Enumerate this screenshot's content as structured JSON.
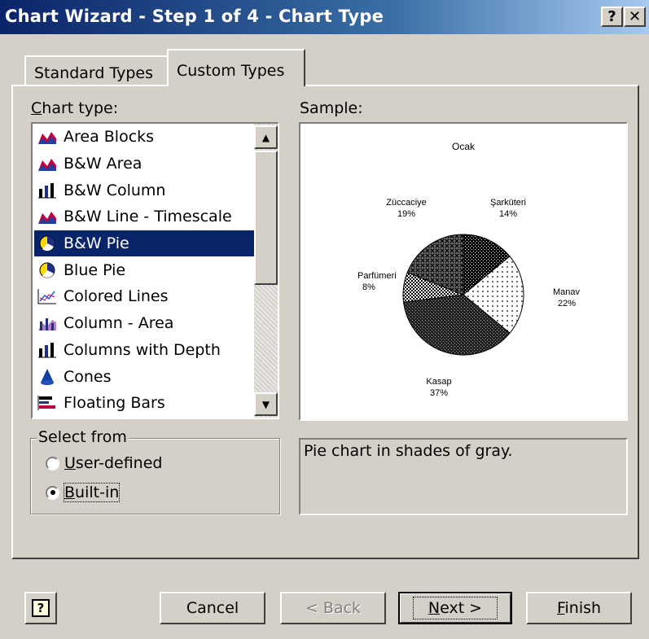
{
  "window": {
    "title": "Chart Wizard - Step 1 of 4 - Chart Type",
    "help_button": "?",
    "close_button": "✕"
  },
  "tabs": [
    {
      "label": "Standard Types",
      "active": false
    },
    {
      "label": "Custom Types",
      "active": true
    }
  ],
  "chart_type": {
    "label_accel": "C",
    "label_rest": "hart type:",
    "items": [
      {
        "label": "Area Blocks",
        "icon": "area-chart-icon"
      },
      {
        "label": "B&W Area",
        "icon": "area-chart-icon"
      },
      {
        "label": "B&W Column",
        "icon": "column-chart-icon"
      },
      {
        "label": "B&W Line - Timescale",
        "icon": "area-chart-icon"
      },
      {
        "label": "B&W Pie",
        "icon": "pie-chart-icon",
        "selected": true
      },
      {
        "label": "Blue Pie",
        "icon": "pie-chart-icon"
      },
      {
        "label": "Colored Lines",
        "icon": "line-chart-icon"
      },
      {
        "label": "Column - Area",
        "icon": "column-area-chart-icon"
      },
      {
        "label": "Columns with Depth",
        "icon": "column-chart-icon"
      },
      {
        "label": "Cones",
        "icon": "cone-chart-icon"
      },
      {
        "label": "Floating Bars",
        "icon": "bar-chart-icon"
      }
    ]
  },
  "sample": {
    "label": "Sample:",
    "chart_data": {
      "type": "pie",
      "title": "Ocak",
      "slices": [
        {
          "label": "Şarküteri",
          "value": 14,
          "display": "14%"
        },
        {
          "label": "Manav",
          "value": 22,
          "display": "22%"
        },
        {
          "label": "Kasap",
          "value": 37,
          "display": "37%"
        },
        {
          "label": "Parfümeri",
          "value": 8,
          "display": "8%"
        },
        {
          "label": "Züccaciye",
          "value": 19,
          "display": "19%"
        }
      ],
      "colors": "shades of gray patterns"
    }
  },
  "select_from": {
    "legend": "Select from",
    "options": [
      {
        "accel": "U",
        "rest": "ser-defined",
        "checked": false
      },
      {
        "accel": "B",
        "rest": "uilt-in",
        "checked": true
      }
    ]
  },
  "description": "Pie chart in shades of gray.",
  "buttons": {
    "help": "?",
    "cancel": "Cancel",
    "back": "< Back",
    "next_accel": "N",
    "next_rest": "ext >",
    "finish_accel": "F",
    "finish_rest": "inish"
  }
}
